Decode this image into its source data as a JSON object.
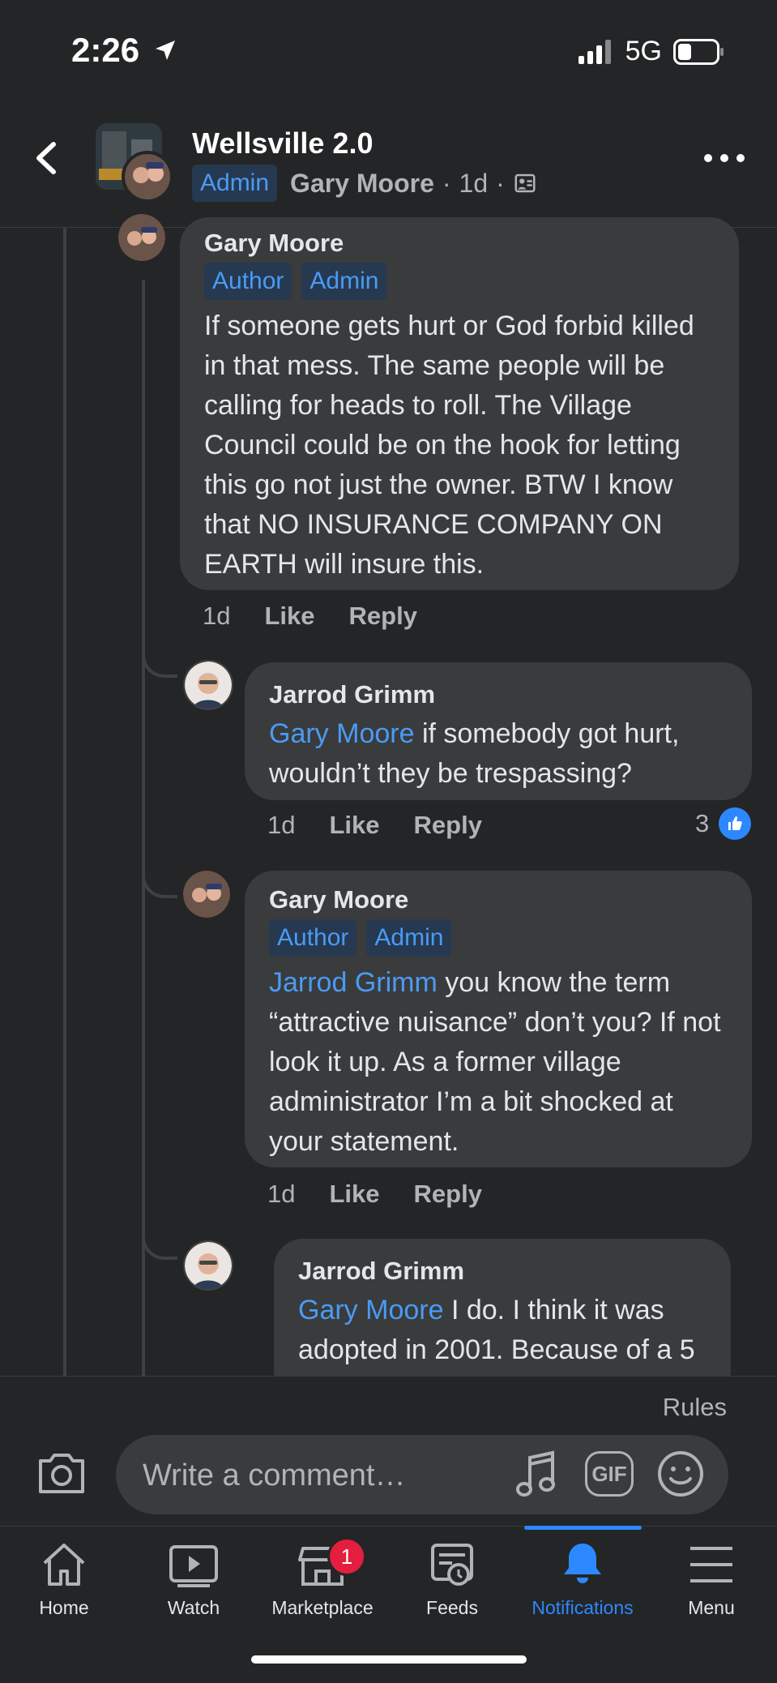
{
  "status_bar": {
    "time": "2:26",
    "network": "5G"
  },
  "header": {
    "group_name": "Wellsville 2.0",
    "role_badge": "Admin",
    "author": "Gary Moore",
    "time": "1d",
    "separator": "·"
  },
  "comments": [
    {
      "name": "Gary Moore",
      "badges": [
        "Author",
        "Admin"
      ],
      "text": "If someone gets hurt or God forbid killed in that mess. The same people will be calling for heads to roll. The Village Council could be on the hook for letting this go not just the owner. BTW I know that NO INSURANCE COMPANY ON EARTH will insure this.",
      "time": "1d",
      "like": "Like",
      "reply": "Reply"
    },
    {
      "name": "Jarrod Grimm",
      "mention": "Gary Moore",
      "text": " if somebody got hurt, wouldn’t they be trespassing?",
      "time": "1d",
      "like": "Like",
      "reply": "Reply",
      "reaction_count": "3"
    },
    {
      "name": "Gary Moore",
      "badges": [
        "Author",
        "Admin"
      ],
      "mention": "Jarrod Grimm",
      "text": " you know the term “attractive nuisance” don’t you? If not look it up. As a former village administrator I’m a bit shocked at your statement.",
      "time": "1d",
      "like": "Like",
      "reply": "Reply"
    },
    {
      "name": "Jarrod Grimm",
      "mention": "Gary Moore",
      "text": " I do. I think it was adopted in 2001. Because of a 5"
    }
  ],
  "composer": {
    "rules": "Rules",
    "placeholder": "Write a comment…",
    "gif_label": "GIF"
  },
  "nav": {
    "items": [
      {
        "label": "Home",
        "icon": "home-icon"
      },
      {
        "label": "Watch",
        "icon": "watch-icon"
      },
      {
        "label": "Marketplace",
        "icon": "marketplace-icon",
        "badge": "1"
      },
      {
        "label": "Feeds",
        "icon": "feeds-icon"
      },
      {
        "label": "Notifications",
        "icon": "bell-icon",
        "active": true
      },
      {
        "label": "Menu",
        "icon": "menu-icon"
      }
    ]
  },
  "colors": {
    "accent": "#2d88ff",
    "link": "#4a9bf5",
    "background": "#242526",
    "bubble": "#3a3b3c",
    "badge_red": "#e41e3f"
  }
}
